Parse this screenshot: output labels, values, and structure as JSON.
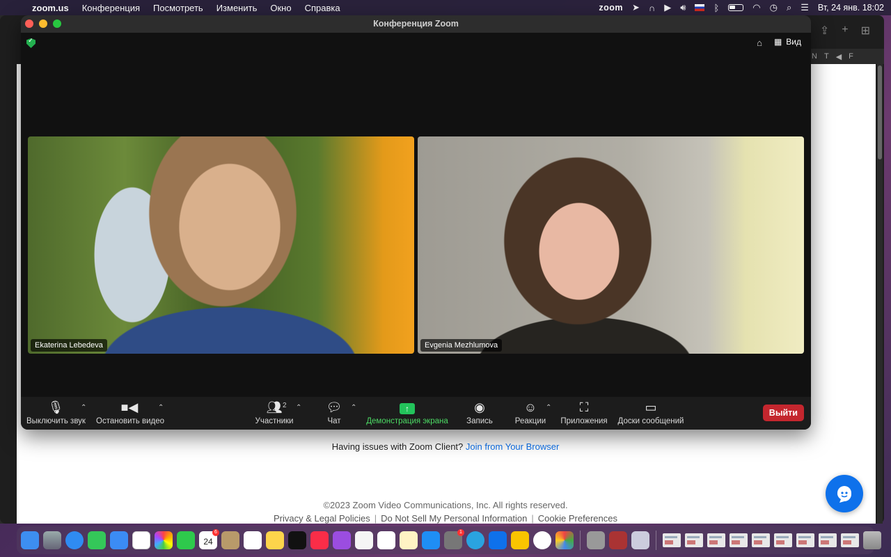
{
  "menubar": {
    "app_name": "zoom.us",
    "items": [
      "Конференция",
      "Посмотреть",
      "Изменить",
      "Окно",
      "Справка"
    ],
    "zoom_status": "zoom",
    "datetime": "Вт, 24 янв.  18:02"
  },
  "zoom_window": {
    "title": "Конференция Zoom",
    "view_label": "Вид",
    "participants": [
      {
        "name": "Ekaterina Lebedeva"
      },
      {
        "name": "Evgenia Mezhlumova"
      }
    ],
    "toolbar": {
      "mute_label": "Выключить звук",
      "video_label": "Остановить видео",
      "participants_label": "Участники",
      "participants_count": "2",
      "chat_label": "Чат",
      "share_label": "Демонстрация экрана",
      "record_label": "Запись",
      "reactions_label": "Реакции",
      "apps_label": "Приложения",
      "whiteboards_label": "Доски сообщений",
      "leave_label": "Выйти"
    }
  },
  "browser_page": {
    "issues_text": "Having issues with Zoom Client?",
    "issues_link": "Join from Your Browser",
    "copyright": "©2023 Zoom Video Communications, Inc. All rights reserved.",
    "footer_links": [
      "Privacy & Legal Policies",
      "Do Not Sell My Personal Information",
      "Cookie Preferences"
    ]
  },
  "dock": {
    "calendar_day": "24",
    "calendar_month": "ЯНВ"
  },
  "colors": {
    "accent_blue": "#0e71eb",
    "share_green": "#23c35b",
    "leave_red": "#c4262e"
  }
}
